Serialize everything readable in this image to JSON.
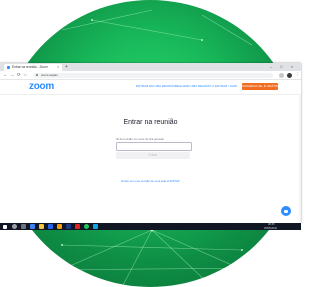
{
  "browser": {
    "tab_title": "Entrar na reunião - Zoom",
    "tab_close": "×",
    "new_tab": "+",
    "url": "zoom.us/join",
    "win_min": "–",
    "win_max": "□",
    "win_close": "×",
    "back": "←",
    "forward": "→",
    "reload": "⟳",
    "home": "⌂"
  },
  "zoom": {
    "logo": "zoom",
    "nav_links": [
      "ENTRAR EM UMA REUNIÃO",
      "REALIZAR UMA REUNIÃO ▾",
      "ENTRAR / SAIR"
    ],
    "signup": "INSCREVA-SE, É GRÁTIS"
  },
  "join": {
    "title": "Entrar na reunião",
    "field_label": "ID da reunião ou nome do link pessoal",
    "placeholder": "Enter Meeting ID or Personal Link Name",
    "button": "Entrar",
    "h323_link": "Entrar em uma reunião de uma sala H.323/SIP"
  },
  "taskbar": {
    "time": "08:45",
    "date": "05/05/2020"
  },
  "colors": {
    "zoom_blue": "#2d8cff",
    "signup_orange": "#f26d21",
    "background_green": "#18b85a"
  }
}
